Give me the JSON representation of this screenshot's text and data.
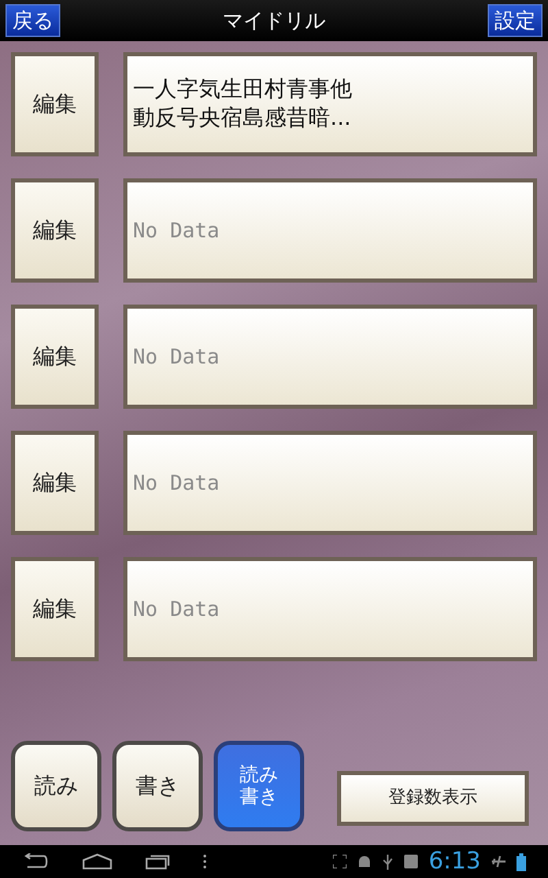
{
  "header": {
    "back_button": "戻る",
    "title": "マイドリル",
    "settings_button": "設定"
  },
  "drills": [
    {
      "edit_button": "編集",
      "kind": "text",
      "content": "一人字気生田村青事他動反号央宿島感昔暗..."
    },
    {
      "edit_button": "編集",
      "kind": "empty",
      "content": "No Data"
    },
    {
      "edit_button": "編集",
      "kind": "empty",
      "content": "No Data"
    },
    {
      "edit_button": "編集",
      "kind": "empty",
      "content": "No Data"
    },
    {
      "edit_button": "編集",
      "kind": "empty",
      "content": "No Data"
    }
  ],
  "modes": [
    {
      "label": "読み",
      "selected": false
    },
    {
      "label": "書き",
      "selected": false
    },
    {
      "label": "読み書き",
      "selected": true
    }
  ],
  "count_button": "登録数表示",
  "status_bar": {
    "time": "6:13"
  }
}
